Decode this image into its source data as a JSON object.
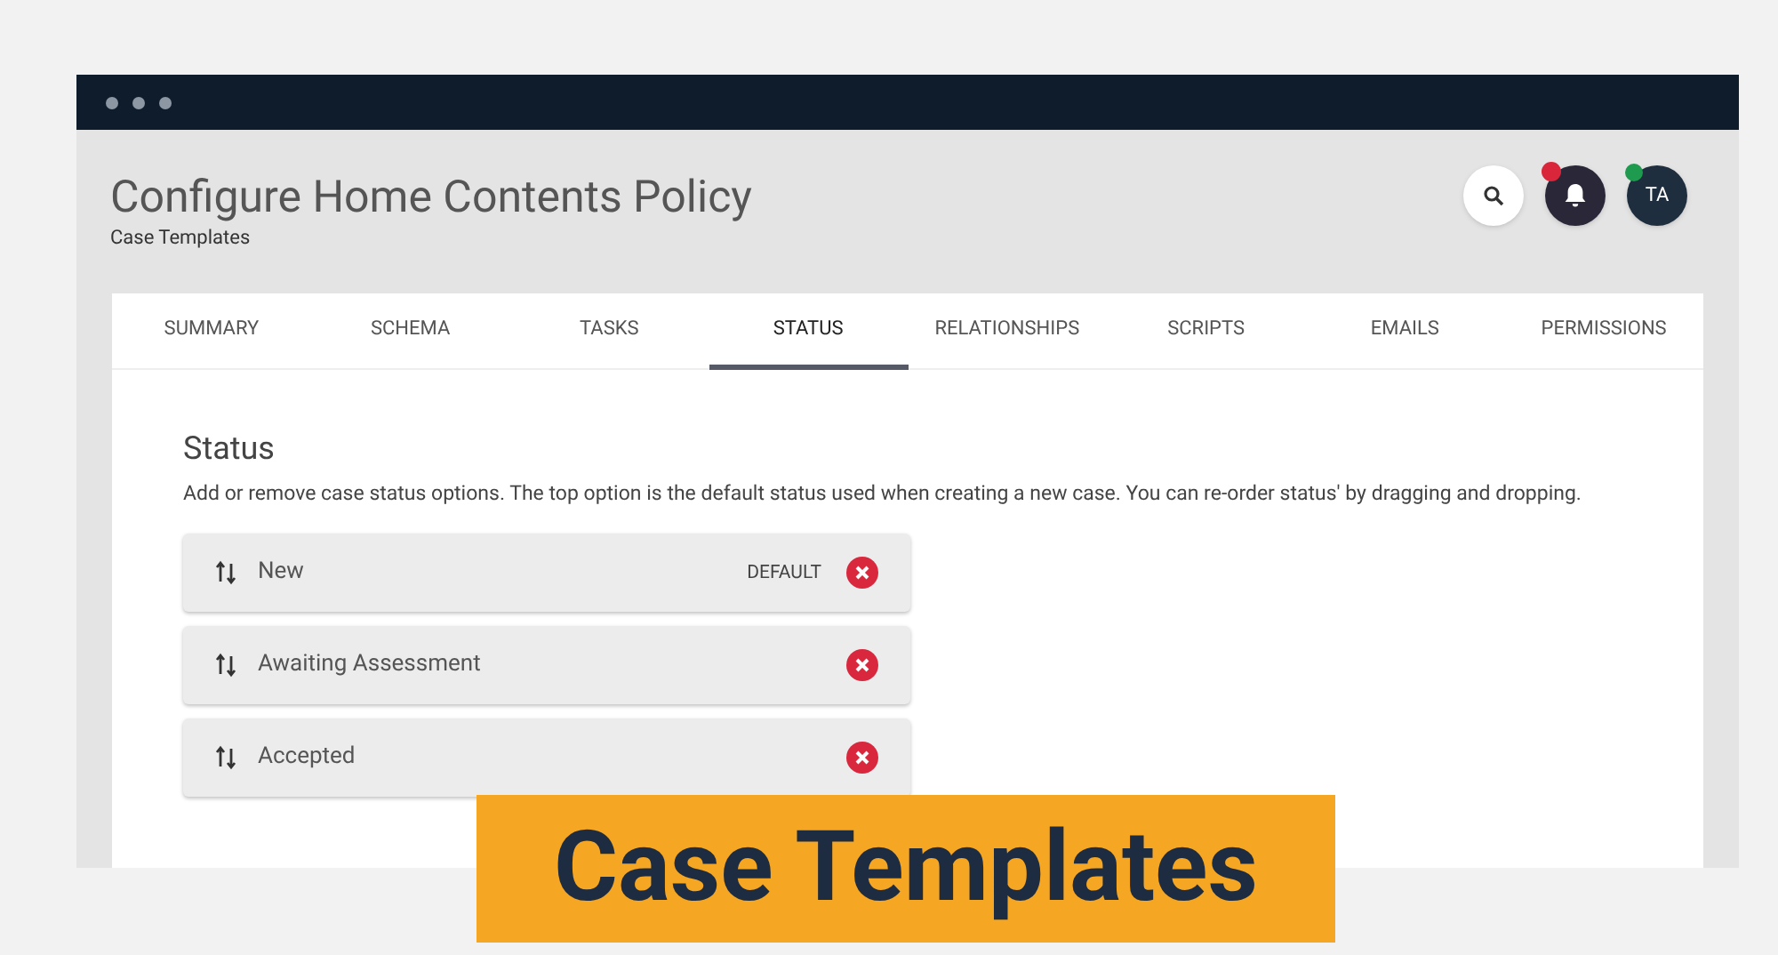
{
  "page": {
    "title": "Configure Home Contents Policy",
    "subtitle": "Case Templates"
  },
  "header_actions": {
    "avatar_initials": "TA",
    "online": true,
    "has_notifications": true
  },
  "tabs": [
    {
      "label": "SUMMARY",
      "selected": false
    },
    {
      "label": "SCHEMA",
      "selected": false
    },
    {
      "label": "TASKS",
      "selected": false
    },
    {
      "label": "STATUS",
      "selected": true
    },
    {
      "label": "RELATIONSHIPS",
      "selected": false
    },
    {
      "label": "SCRIPTS",
      "selected": false
    },
    {
      "label": "EMAILS",
      "selected": false
    },
    {
      "label": "PERMISSIONS",
      "selected": false
    }
  ],
  "section": {
    "heading": "Status",
    "description": "Add or remove case status options. The top option is the default status used when creating a new case. You can re-order status' by dragging and dropping."
  },
  "statuses": [
    {
      "name": "New",
      "badge": "DEFAULT"
    },
    {
      "name": "Awaiting Assessment"
    },
    {
      "name": "Accepted"
    }
  ],
  "banner": {
    "text": "Case Templates"
  }
}
